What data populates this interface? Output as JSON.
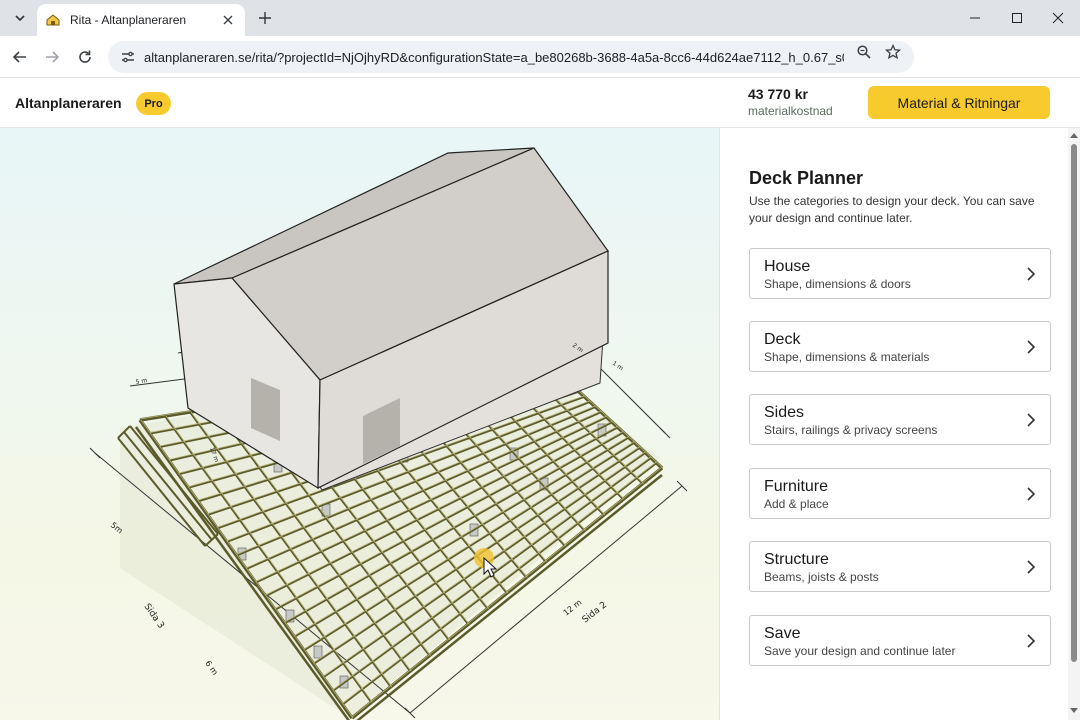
{
  "browser": {
    "tab_title": "Rita - Altanplaneraren",
    "url": "altanplaneraren.se/rita/?projectId=NjOjhyRD&configurationState=a_be80268b-3688-4a5a-8cc6-44d624ae7112_h_0.67_s0t_2..."
  },
  "header": {
    "app_name": "Altanplaneraren",
    "badge": "Pro",
    "cost_amount": "43 770 kr",
    "cost_label": "materialkostnad",
    "cta_label": "Material & Ritningar"
  },
  "viewport": {
    "dim_labels": [
      "5m",
      "Sida 3",
      "6 m",
      "12 m",
      "Sida 2",
      "17 m",
      "2 m",
      "1 m",
      "5 m"
    ]
  },
  "panel": {
    "title": "Deck Planner",
    "description": "Use the categories to design your deck. You can save your design and continue later.",
    "categories": [
      {
        "title": "House",
        "subtitle": "Shape, dimensions & doors"
      },
      {
        "title": "Deck",
        "subtitle": "Shape, dimensions & materials"
      },
      {
        "title": "Sides",
        "subtitle": "Stairs, railings & privacy screens"
      },
      {
        "title": "Furniture",
        "subtitle": "Add & place"
      },
      {
        "title": "Structure",
        "subtitle": "Beams, joists & posts"
      },
      {
        "title": "Save",
        "subtitle": "Save your design and continue later"
      }
    ]
  },
  "colors": {
    "accent": "#f7ca2e",
    "deck_frame": "#5a5a2a",
    "house_wall": "#e6e3df",
    "house_roof": "#cfccc7"
  }
}
